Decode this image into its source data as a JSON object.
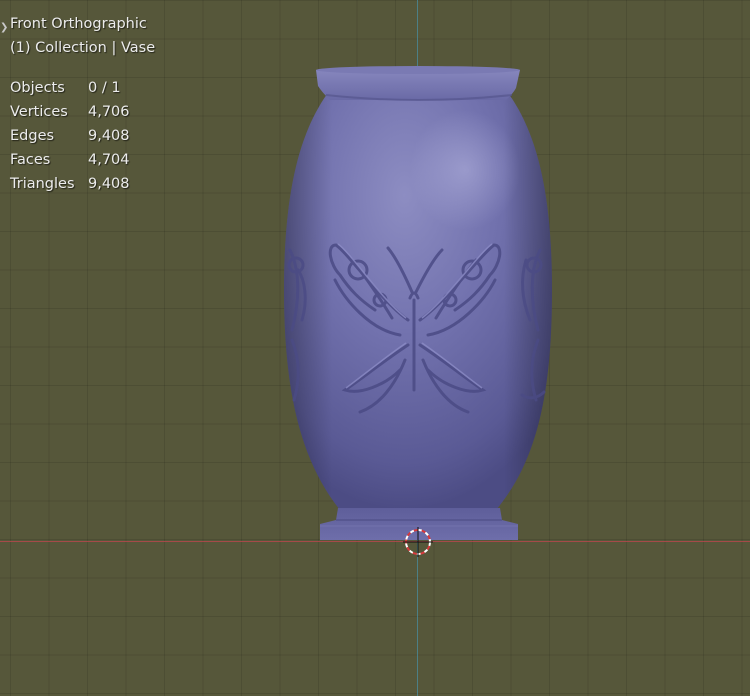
{
  "viewport": {
    "view_name": "Front Orthographic",
    "collection_info": "(1) Collection | Vase",
    "stats": [
      {
        "label": "Objects",
        "value": "0 / 1"
      },
      {
        "label": "Vertices",
        "value": "4,706"
      },
      {
        "label": "Edges",
        "value": "9,408"
      },
      {
        "label": "Faces",
        "value": "4,704"
      },
      {
        "label": "Triangles",
        "value": "9,408"
      }
    ]
  },
  "icons": {
    "collapse": "chevron-right-icon",
    "cursor": "3d-cursor-icon"
  },
  "colors": {
    "background": "#56573a",
    "vase": "#6a6aa6",
    "x_axis": "#b3484c",
    "y_axis": "#4a8a9a"
  }
}
